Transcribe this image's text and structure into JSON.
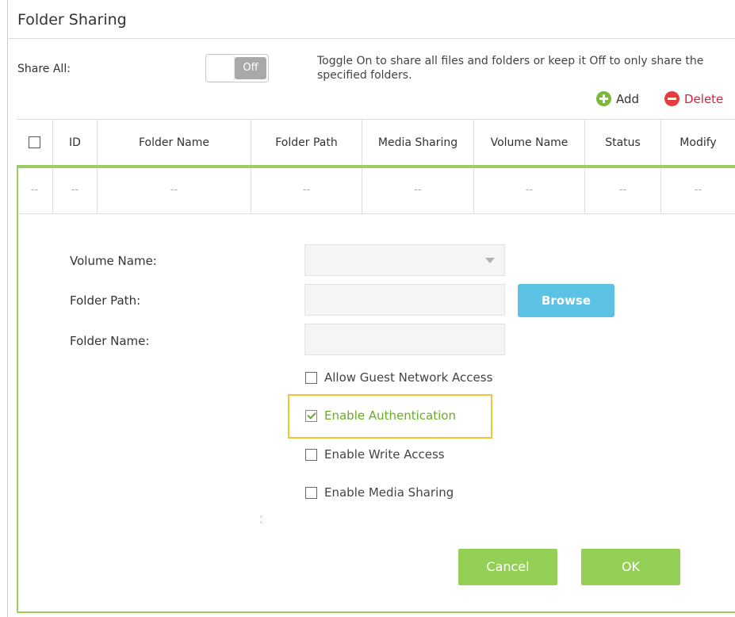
{
  "page": {
    "title": "Folder Sharing"
  },
  "share_all": {
    "label": "Share All:",
    "toggle_state": "Off",
    "help_text": "Toggle On to share all files and folders or keep it Off to only share the specified folders."
  },
  "actions": {
    "add_label": "Add",
    "delete_label": "Delete"
  },
  "table": {
    "columns": [
      "ID",
      "Folder Name",
      "Folder Path",
      "Media Sharing",
      "Volume Name",
      "Status",
      "Modify"
    ],
    "empty_row": [
      "--",
      "--",
      "--",
      "--",
      "--",
      "--",
      "--",
      "--"
    ]
  },
  "form": {
    "volume_name_label": "Volume Name:",
    "volume_name_value": "",
    "folder_path_label": "Folder Path:",
    "folder_path_value": "",
    "browse_label": "Browse",
    "folder_name_label": "Folder Name:",
    "folder_name_value": "",
    "options": [
      {
        "label": "Allow Guest Network Access",
        "checked": false
      },
      {
        "label": "Enable Authentication",
        "checked": true
      },
      {
        "label": "Enable Write Access",
        "checked": false
      },
      {
        "label": "Enable Media Sharing",
        "checked": false
      }
    ],
    "cancel_label": "Cancel",
    "ok_label": "OK"
  },
  "colors": {
    "accent_green": "#94cf56",
    "browse_blue": "#5bc2e3",
    "delete_red": "#e33d3d",
    "highlight_yellow": "#f2c23b"
  }
}
